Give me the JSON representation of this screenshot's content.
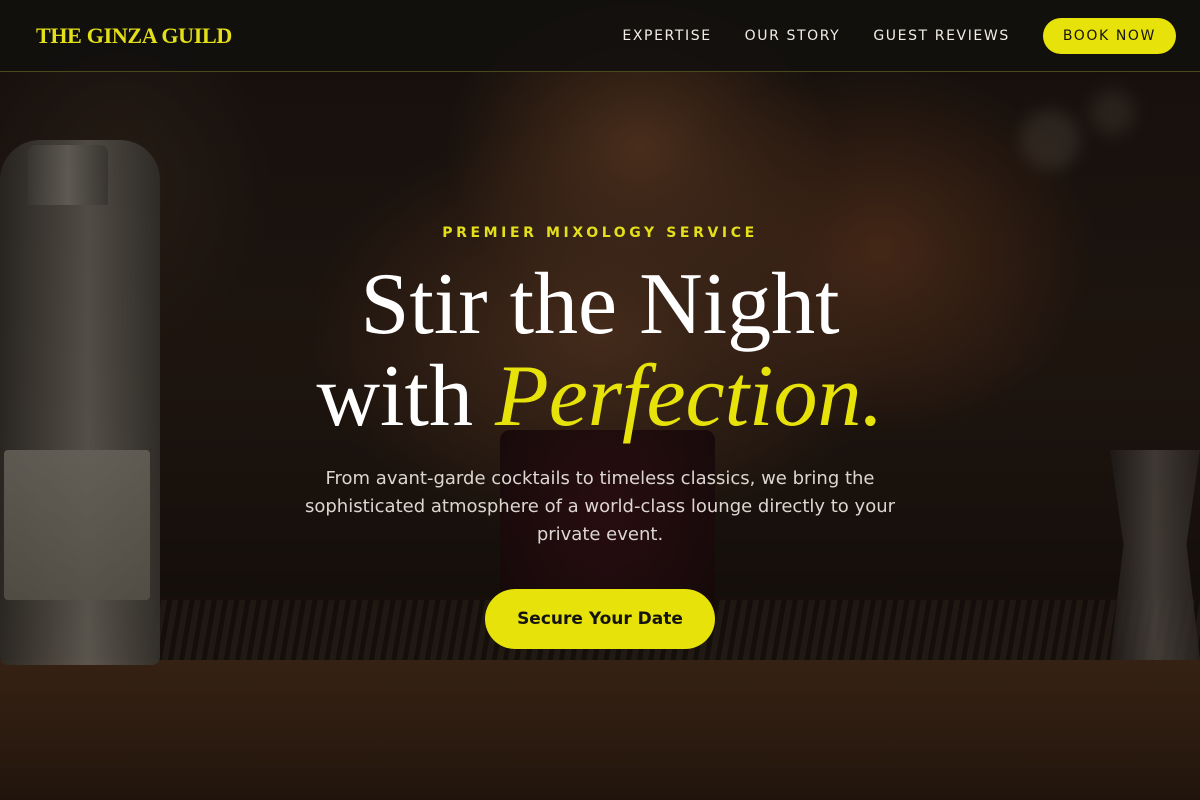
{
  "header": {
    "brand": "THE GINZA GUILD",
    "nav": [
      "EXPERTISE",
      "OUR STORY",
      "GUEST REVIEWS"
    ],
    "book_label": "BOOK NOW"
  },
  "hero": {
    "eyebrow": "PREMIER MIXOLOGY SERVICE",
    "headline_line1": "Stir the Night",
    "headline_line2_prefix": "with ",
    "headline_accent": "Perfection.",
    "subtitle": "From avant-garde cocktails to timeless classics, we bring the sophisticated atmosphere of a world-class lounge directly to your private event.",
    "cta_label": "Secure Your Date"
  },
  "colors": {
    "accent": "#e6e20a",
    "header_bg": "#12100e",
    "text_light": "#ffffff"
  }
}
